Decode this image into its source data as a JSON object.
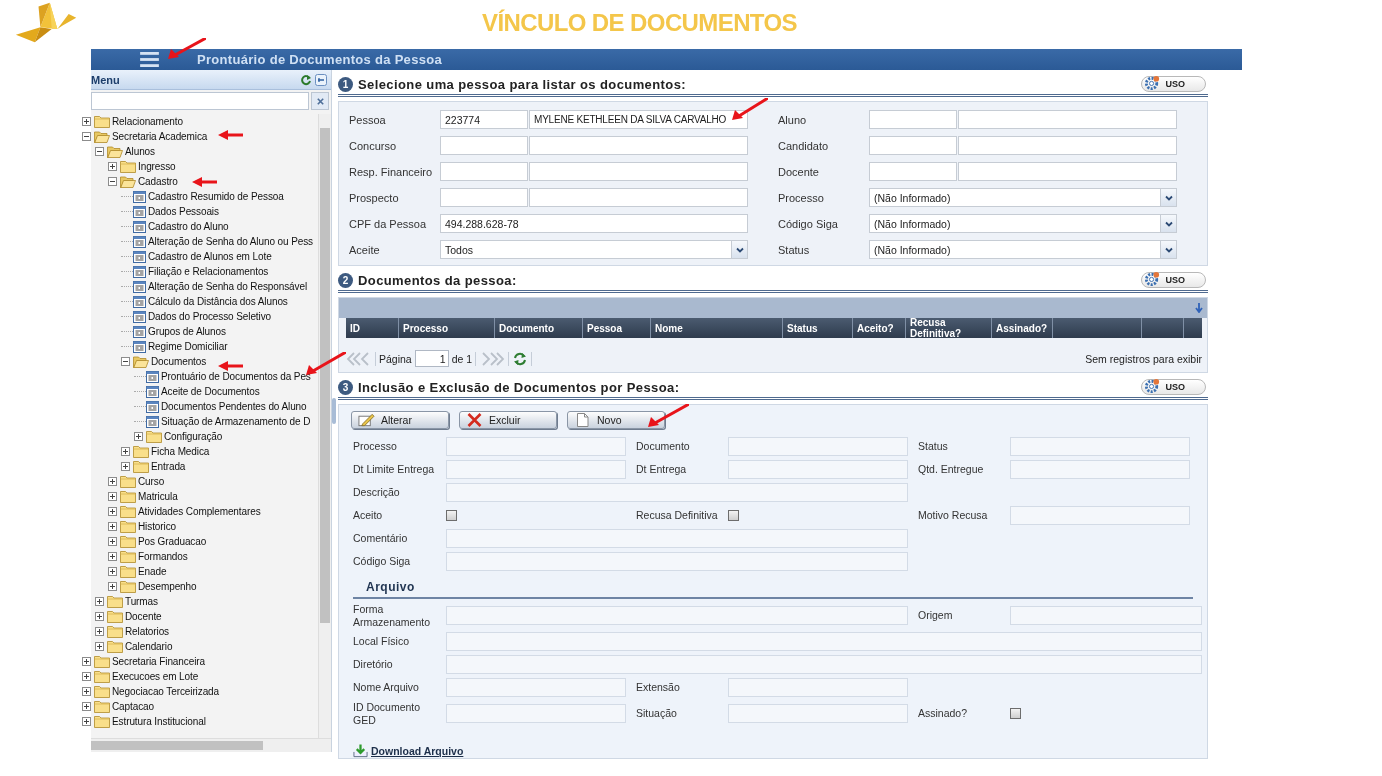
{
  "page_title": "VÍNCULO DE DOCUMENTOS",
  "window": {
    "title": "Prontuário de Documentos da Pessoa"
  },
  "sidebar": {
    "title": "Menu",
    "tree": [
      {
        "label": "Relacionamento",
        "kind": "folder",
        "expanded": false
      },
      {
        "label": "Secretaria Academica",
        "kind": "folder",
        "expanded": true,
        "children": [
          {
            "label": "Alunos",
            "kind": "folder",
            "expanded": true,
            "children": [
              {
                "label": "Ingresso",
                "kind": "folder",
                "expanded": false
              },
              {
                "label": "Cadastro",
                "kind": "folder",
                "expanded": true,
                "children": [
                  {
                    "label": "Cadastro Resumido de Pessoa",
                    "kind": "page"
                  },
                  {
                    "label": "Dados Pessoais",
                    "kind": "page"
                  },
                  {
                    "label": "Cadastro do Aluno",
                    "kind": "page"
                  },
                  {
                    "label": "Alteração de Senha do Aluno ou Pess",
                    "kind": "page"
                  },
                  {
                    "label": "Cadastro de Alunos em Lote",
                    "kind": "page"
                  },
                  {
                    "label": "Filiação e Relacionamentos",
                    "kind": "page"
                  },
                  {
                    "label": "Alteração de Senha do Responsável",
                    "kind": "page"
                  },
                  {
                    "label": "Cálculo da Distância dos Alunos",
                    "kind": "page"
                  },
                  {
                    "label": "Dados do Processo Seletivo",
                    "kind": "page"
                  },
                  {
                    "label": "Grupos de Alunos",
                    "kind": "page"
                  },
                  {
                    "label": "Regime Domiciliar",
                    "kind": "page"
                  },
                  {
                    "label": "Documentos",
                    "kind": "folder",
                    "expanded": true,
                    "children": [
                      {
                        "label": "Prontuário de Documentos da Pes",
                        "kind": "page"
                      },
                      {
                        "label": "Aceite de Documentos",
                        "kind": "page"
                      },
                      {
                        "label": "Documentos Pendentes do Aluno",
                        "kind": "page"
                      },
                      {
                        "label": "Situação de Armazenamento de D",
                        "kind": "page"
                      },
                      {
                        "label": "Configuração",
                        "kind": "folder",
                        "expanded": false
                      }
                    ]
                  },
                  {
                    "label": "Ficha Medica",
                    "kind": "folder",
                    "expanded": false
                  },
                  {
                    "label": "Entrada",
                    "kind": "folder",
                    "expanded": false
                  }
                ]
              },
              {
                "label": "Curso",
                "kind": "folder",
                "expanded": false
              },
              {
                "label": "Matricula",
                "kind": "folder",
                "expanded": false
              },
              {
                "label": "Atividades Complementares",
                "kind": "folder",
                "expanded": false
              },
              {
                "label": "Historico",
                "kind": "folder",
                "expanded": false
              },
              {
                "label": "Pos Graduacao",
                "kind": "folder",
                "expanded": false
              },
              {
                "label": "Formandos",
                "kind": "folder",
                "expanded": false
              },
              {
                "label": "Enade",
                "kind": "folder",
                "expanded": false
              },
              {
                "label": "Desempenho",
                "kind": "folder",
                "expanded": false
              }
            ]
          },
          {
            "label": "Turmas",
            "kind": "folder",
            "expanded": false
          },
          {
            "label": "Docente",
            "kind": "folder",
            "expanded": false
          },
          {
            "label": "Relatorios",
            "kind": "folder",
            "expanded": false
          },
          {
            "label": "Calendario",
            "kind": "folder",
            "expanded": false
          }
        ]
      },
      {
        "label": "Secretaria Financeira",
        "kind": "folder",
        "expanded": false
      },
      {
        "label": "Execucoes em Lote",
        "kind": "folder",
        "expanded": false
      },
      {
        "label": "Negociacao Terceirizada",
        "kind": "folder",
        "expanded": false
      },
      {
        "label": "Captacao",
        "kind": "folder",
        "expanded": false
      },
      {
        "label": "Estrutura Institucional",
        "kind": "folder",
        "expanded": false
      }
    ]
  },
  "search_section": {
    "number": "1",
    "title": "Selecione uma pessoa para listar os documentos:",
    "usage_button": "USO",
    "fields": [
      {
        "label": "Pessoa",
        "kind": "pair",
        "code": "223774",
        "value": "MYLENE KETHLEEN DA SILVA CARVALHO"
      },
      {
        "label": "Aluno",
        "kind": "pair"
      },
      {
        "label": "Concurso",
        "kind": "pair"
      },
      {
        "label": "Candidato",
        "kind": "pair"
      },
      {
        "label": "Resp. Financeiro",
        "kind": "pair"
      },
      {
        "label": "Docente",
        "kind": "pair"
      },
      {
        "label": "Prospecto",
        "kind": "pair"
      },
      {
        "label": "Processo",
        "kind": "select",
        "value": "(Não Informado)"
      },
      {
        "label": "CPF da Pessoa",
        "kind": "text",
        "value": "494.288.628-78"
      },
      {
        "label": "Código Siga",
        "kind": "select",
        "value": "(Não Informado)"
      },
      {
        "label": "Aceite",
        "kind": "select",
        "value": "Todos"
      },
      {
        "label": "Status",
        "kind": "select",
        "value": "(Não Informado)"
      }
    ]
  },
  "documents_section": {
    "number": "2",
    "title": "Documentos da pessoa:",
    "usage_button": "USO",
    "table": {
      "columns": [
        "ID",
        "Processo",
        "Documento",
        "Pessoa",
        "Nome",
        "Status",
        "Aceito?",
        "Recusa Definitiva?",
        "Assinado?"
      ]
    },
    "pager": {
      "page_label": "Página",
      "page": "1",
      "total": "de 1",
      "status": "Sem registros para exibir"
    }
  },
  "edit_section": {
    "number": "3",
    "title": "Inclusão e Exclusão de Documentos por Pessoa:",
    "usage_button": "USO",
    "buttons": [
      {
        "label": "Alterar",
        "kind": "edit"
      },
      {
        "label": "Excluir",
        "kind": "delete"
      },
      {
        "label": "Novo",
        "kind": "new"
      }
    ],
    "rows": [
      [
        {
          "label": "Processo",
          "kind": "field"
        },
        {
          "label": "Documento",
          "kind": "field"
        },
        {
          "label": "Status",
          "kind": "field"
        }
      ],
      [
        {
          "label": "Dt Limite Entrega",
          "kind": "field"
        },
        {
          "label": "Dt Entrega",
          "kind": "field"
        },
        {
          "label": "Qtd. Entregue",
          "kind": "field"
        }
      ],
      [
        {
          "label": "Descrição",
          "kind": "long"
        }
      ],
      [
        {
          "label": "Aceito",
          "kind": "checkbox",
          "checked": false
        },
        {
          "label": "Recusa Definitiva",
          "kind": "checkbox",
          "checked": false
        },
        {
          "label": "Motivo Recusa",
          "kind": "field"
        }
      ],
      [
        {
          "label": "Comentário",
          "kind": "long"
        }
      ],
      [
        {
          "label": "Código Siga",
          "kind": "long"
        }
      ]
    ],
    "file_heading": "Arquivo",
    "file_rows": [
      [
        {
          "label": "Forma Armazenamento",
          "kind": "long"
        },
        {
          "label": "Origem",
          "kind": "field"
        }
      ],
      [
        {
          "label": "Local Físico",
          "kind": "full"
        }
      ],
      [
        {
          "label": "Diretório",
          "kind": "full"
        }
      ],
      [
        {
          "label": "Nome Arquivo",
          "kind": "field"
        },
        {
          "label": "Extensão",
          "kind": "field"
        }
      ],
      [
        {
          "label": "ID Documento GED",
          "kind": "field"
        },
        {
          "label": "Situação",
          "kind": "field"
        },
        {
          "label": "Assinado?",
          "kind": "checkbox",
          "checked": false
        }
      ]
    ],
    "download_link": "Download Arquivo"
  }
}
